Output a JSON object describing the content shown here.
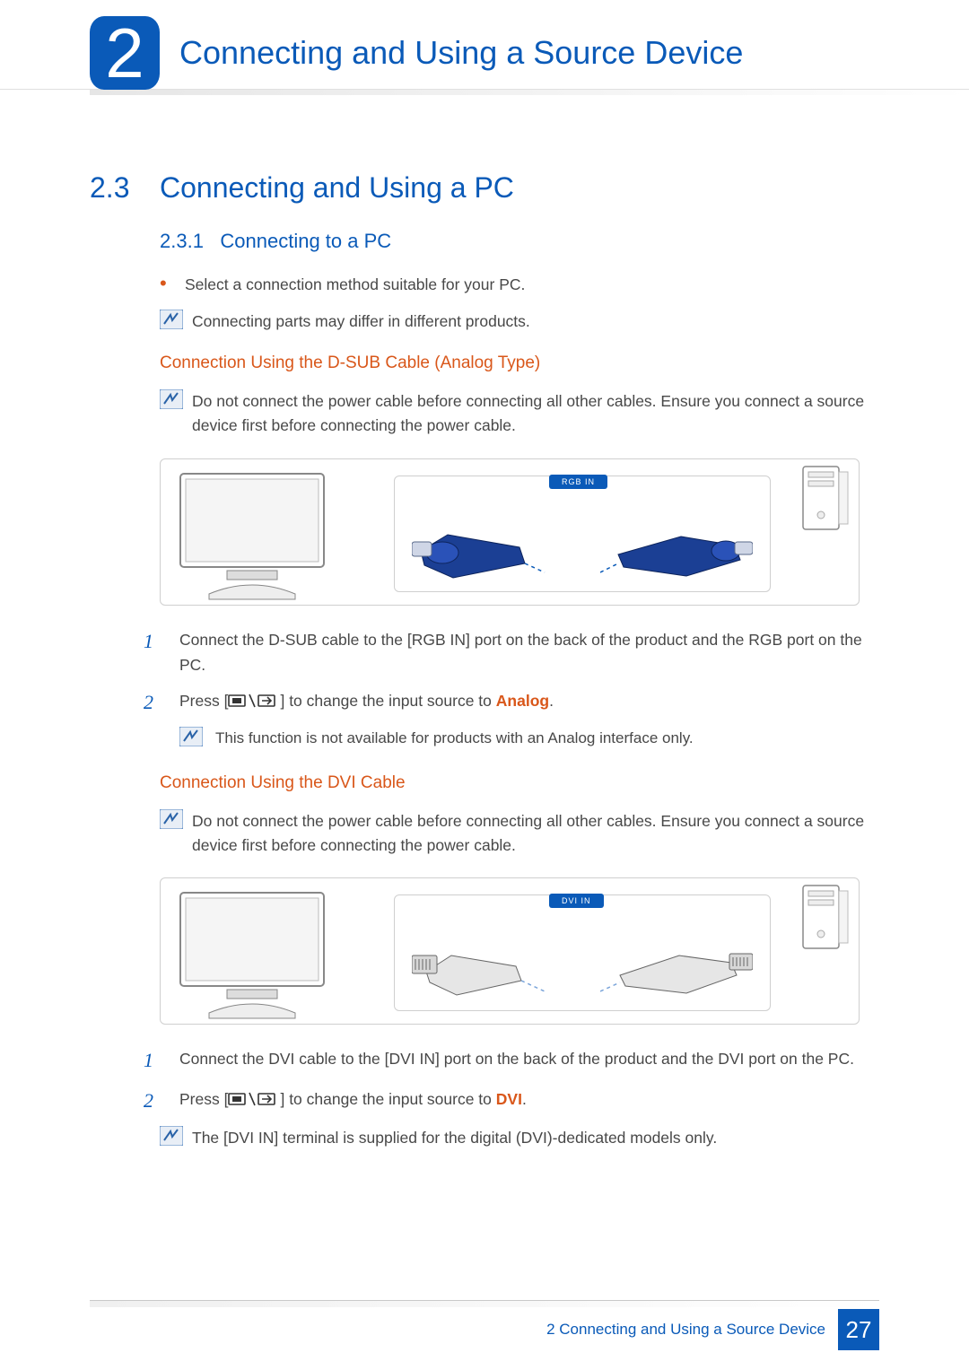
{
  "header": {
    "chapter_number": "2",
    "chapter_title": "Connecting and Using a Source Device"
  },
  "section": {
    "number": "2.3",
    "title": "Connecting and Using a PC"
  },
  "subsection": {
    "number": "2.3.1",
    "title": "Connecting to a PC"
  },
  "intro": {
    "bullet": "Select a connection method suitable for your PC.",
    "note": "Connecting parts may differ in different products."
  },
  "dsub": {
    "heading": "Connection Using the D-SUB Cable (Analog Type)",
    "warning": "Do not connect the power cable before connecting all other cables. Ensure you connect a source device first before connecting the power cable.",
    "port_label": "RGB IN",
    "step1": "Connect the D-SUB cable to the [RGB IN] port on the back of the product and the RGB port on the PC.",
    "step2_a": "Press [",
    "step2_b": "] to change the input source to ",
    "step2_emph": "Analog",
    "step2_c": ".",
    "subnote": "This function is not available for products with an Analog interface only."
  },
  "dvi": {
    "heading": "Connection Using the DVI Cable",
    "warning": "Do not connect the power cable before connecting all other cables. Ensure you connect a source device first before connecting the power cable.",
    "port_label": "DVI IN",
    "step1": "Connect the DVI cable to the [DVI IN] port on the back of the product and the DVI port on the PC.",
    "step2_a": "Press [",
    "step2_b": "] to change the input source to ",
    "step2_emph": "DVI",
    "step2_c": ".",
    "subnote": "The [DVI IN] terminal is supplied for the digital (DVI)-dedicated models only."
  },
  "steps": {
    "one": "1",
    "two": "2"
  },
  "footer": {
    "text": "2 Connecting and Using a Source Device",
    "page": "27"
  }
}
